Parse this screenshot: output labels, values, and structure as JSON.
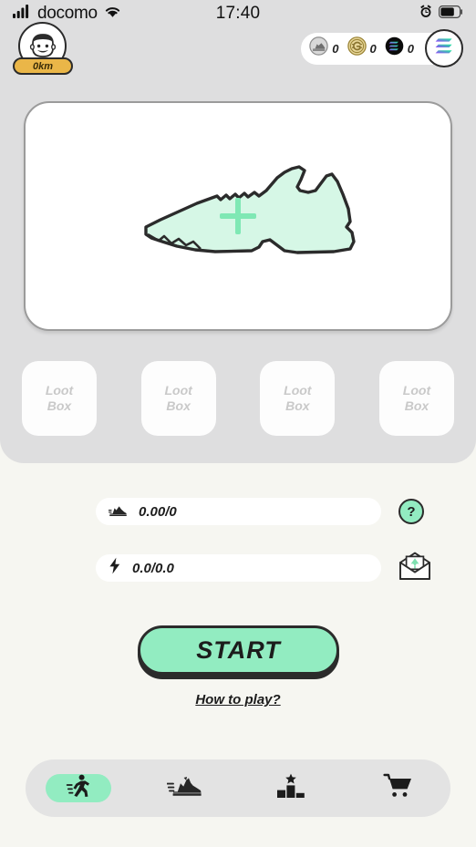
{
  "statusbar": {
    "carrier": "docomo",
    "time": "17:40",
    "signal_icon": "signal-bars-icon",
    "wifi_icon": "wifi-icon",
    "alarm_icon": "alarm-clock-icon",
    "battery_icon": "battery-icon",
    "battery_level": 65
  },
  "header": {
    "avatar_icon": "user-avatar-face-icon",
    "distance_badge": "0km",
    "wallet": {
      "currencies": [
        {
          "icon": "sneaker-coin-icon",
          "value": "0"
        },
        {
          "icon": "gst-gold-coin-icon",
          "value": "0"
        },
        {
          "icon": "solana-black-coin-icon",
          "value": "0"
        }
      ],
      "wallet_button_icon": "solana-logo-icon"
    }
  },
  "shoe_card": {
    "shoe_icon": "sneaker-outline-icon",
    "add_icon": "plus-icon",
    "fill_color": "#d6f7e6",
    "outline_color": "#2b2b2b",
    "plus_color": "#7fe8b4"
  },
  "loot_boxes": [
    {
      "line1": "Loot",
      "line2": "Box"
    },
    {
      "line1": "Loot",
      "line2": "Box"
    },
    {
      "line1": "Loot",
      "line2": "Box"
    },
    {
      "line1": "Loot",
      "line2": "Box"
    }
  ],
  "stats": {
    "distance": {
      "icon": "running-shoe-icon",
      "value": "0.00/0"
    },
    "energy": {
      "icon": "lightning-bolt-icon",
      "value": "0.0/0.0"
    },
    "help_label": "?",
    "help_icon": "question-mark-icon",
    "mail_icon": "envelope-tree-icon"
  },
  "actions": {
    "start_label": "START",
    "how_to_play_label": "How to play?"
  },
  "navbar": {
    "items": [
      {
        "icon": "running-person-icon",
        "name": "run",
        "active": true
      },
      {
        "icon": "sneaker-speed-icon",
        "name": "shoes",
        "active": false
      },
      {
        "icon": "podium-star-icon",
        "name": "leaderboard",
        "active": false
      },
      {
        "icon": "shopping-cart-icon",
        "name": "shop",
        "active": false
      }
    ]
  },
  "colors": {
    "mint": "#92ecc1",
    "panel_gray": "#dededf",
    "page_bg": "#f6f6f1",
    "ink": "#2b2b2b",
    "gold": "#eab648"
  }
}
